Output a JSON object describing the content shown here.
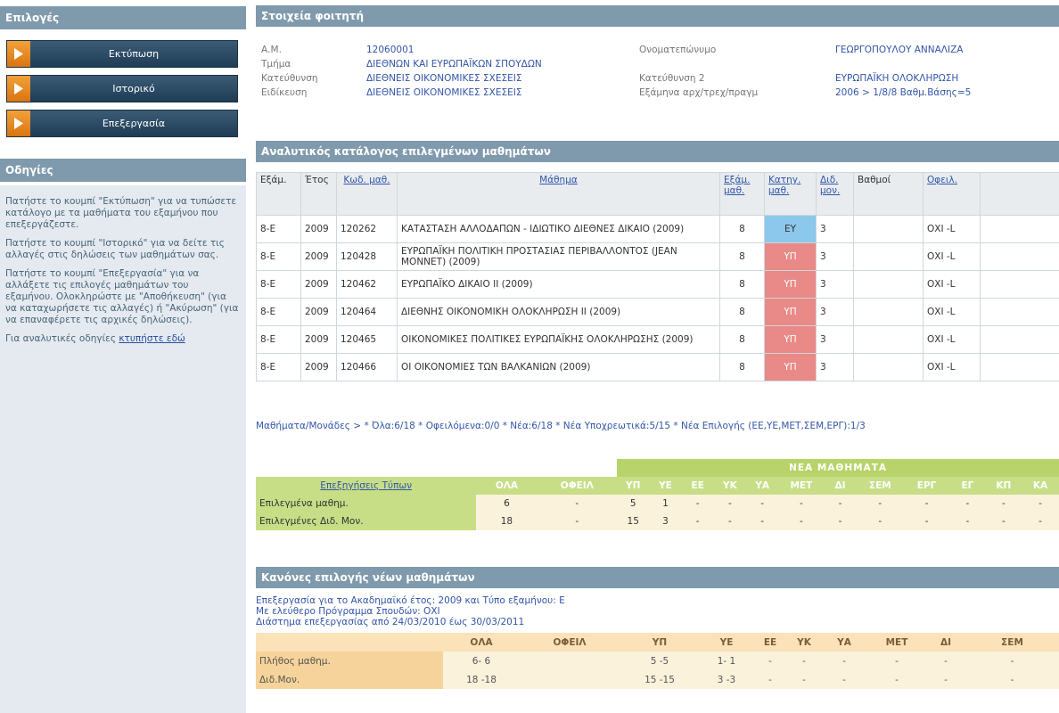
{
  "sidebar": {
    "options_title": "Επιλογές",
    "buttons": [
      {
        "label": "Εκτύπωση"
      },
      {
        "label": "Ιστορικό"
      },
      {
        "label": "Επεξεργασία"
      }
    ],
    "instructions_title": "Οδηγίες",
    "instructions": [
      "Πατήστε το κουμπί \"Εκτύπωση\" για να τυπώσετε κατάλογο με τα μαθήματα του εξαμήνου που επεξεργάζεστε.",
      "Πατήστε το κουμπί \"Ιστορικό\" για να δείτε τις αλλαγές στις δηλώσεις των μαθημάτων σας.",
      "Πατήστε το κουμπί \"Επεξεργασία\" για να αλλάξετε τις επιλογές μαθημάτων του εξαμήνου. Ολοκληρώστε με \"Αποθήκευση\" (για να καταχωρήσετε τις αλλαγές) ή \"Ακύρωση\" (για να επαναφέρετε τις αρχικές δηλώσεις)."
    ],
    "detailed_prefix": "Για αναλυτικές οδηγίες ",
    "detailed_link": "κτυπήστε εδώ"
  },
  "student": {
    "title": "Στοιχεία φοιτητή",
    "am_label": "Α.Μ.",
    "am_value": "12060001",
    "name_label": "Ονοματεπώνυμο",
    "name_value": "ΓΕΩΡΓΟΠΟΥΛΟΥ ΑΝΝΑΛΙΖΑ",
    "dept_label": "Τμήμα",
    "dept_value": "ΔΙΕΘΝΩΝ ΚΑΙ ΕΥΡΩΠΑΪΚΩΝ ΣΠΟΥΔΩΝ",
    "dir_label": "Κατεύθυνση",
    "dir_value": "ΔΙΕΘΝΕΙΣ ΟΙΚΟΝΟΜΙΚΕΣ ΣΧΕΣΕΙΣ",
    "dir2_label": "Κατεύθυνση 2",
    "dir2_value": "ΕΥΡΩΠΑΪΚΗ ΟΛΟΚΛΗΡΩΣΗ",
    "spec_label": "Ειδίκευση",
    "spec_value": "ΔΙΕΘΝΕΙΣ ΟΙΚΟΝΟΜΙΚΕΣ ΣΧΕΣΕΙΣ",
    "sem_label": "Εξάμηνα αρχ/τρεχ/πραγμ",
    "sem_value": "2006 > 1/8/8 Βαθμ.Βάσης=5"
  },
  "courses": {
    "title": "Αναλυτικός κατάλογος επιλεγμένων μαθημάτων",
    "headers": [
      "Εξάμ.",
      "Έτος",
      "Κωδ. μαθ.",
      "Μάθημα",
      "Εξάμ. μαθ.",
      "Κατηγ. μαθ.",
      "Διδ. μον.",
      "Βαθμοί",
      "Οφειλ."
    ],
    "rows": [
      {
        "sem": "8-Ε",
        "year": "2009",
        "code": "120262",
        "title": "ΚΑΤΑΣΤΑΣΗ ΑΛΛΟΔΑΠΩΝ - ΙΔΙΩΤΙΚΟ ΔΙΕΘΝΕΣ ΔΙΚΑΙΟ (2009)",
        "csem": "8",
        "cat": "ΕΥ",
        "units": "3",
        "grade": "",
        "owed": "ΟΧΙ -L"
      },
      {
        "sem": "8-Ε",
        "year": "2009",
        "code": "120428",
        "title": "ΕΥΡΩΠΑΪΚΗ ΠΟΛΙΤΙΚΗ ΠΡΟΣΤΑΣΙΑΣ ΠΕΡΙΒΑΛΛΟΝΤΟΣ (JEAN MONNET) (2009)",
        "csem": "8",
        "cat": "ΥΠ",
        "units": "3",
        "grade": "",
        "owed": "ΟΧΙ -L"
      },
      {
        "sem": "8-Ε",
        "year": "2009",
        "code": "120462",
        "title": "ΕΥΡΩΠΑΪΚΟ ΔΙΚΑΙΟ ΙΙ (2009)",
        "csem": "8",
        "cat": "ΥΠ",
        "units": "3",
        "grade": "",
        "owed": "ΟΧΙ -L"
      },
      {
        "sem": "8-Ε",
        "year": "2009",
        "code": "120464",
        "title": "ΔΙΕΘΝΗΣ ΟΙΚΟΝΟΜΙΚΗ ΟΛΟΚΛΗΡΩΣΗ ΙΙ (2009)",
        "csem": "8",
        "cat": "ΥΠ",
        "units": "3",
        "grade": "",
        "owed": "ΟΧΙ -L"
      },
      {
        "sem": "8-Ε",
        "year": "2009",
        "code": "120465",
        "title": "ΟΙΚΟΝΟΜΙΚΕΣ ΠΟΛΙΤΙΚΕΣ ΕΥΡΩΠΑΪΚΗΣ ΟΛΟΚΛΗΡΩΣΗΣ (2009)",
        "csem": "8",
        "cat": "ΥΠ",
        "units": "3",
        "grade": "",
        "owed": "ΟΧΙ -L"
      },
      {
        "sem": "8-Ε",
        "year": "2009",
        "code": "120466",
        "title": "ΟΙ ΟΙΚΟΝΟΜΙΕΣ ΤΩΝ ΒΑΛΚΑΝΙΩΝ (2009)",
        "csem": "8",
        "cat": "ΥΠ",
        "units": "3",
        "grade": "",
        "owed": "ΟΧΙ -L"
      }
    ],
    "summary": "Μαθήματα/Μονάδες > * Όλα:6/18 * Οφειλόμενα:0/0 * Νέα:6/18 * Νέα Υποχρεωτικά:5/15 * Νέα Επιλογής (ΕΕ,ΥΕ,ΜΕΤ,ΣΕΜ,ΕΡΓ):1/3"
  },
  "stats": {
    "nea_label": "ΝΕΑ ΜΑΘΗΜΑΤΑ",
    "type_link": "Επεξηγήσεις Τύπων",
    "headers": [
      "ΟΛΑ",
      "ΟΦΕΙΛ",
      "ΥΠ",
      "ΥΕ",
      "ΕΕ",
      "ΥΚ",
      "ΥΑ",
      "ΜΕΤ",
      "ΔΙ",
      "ΣΕΜ",
      "ΕΡΓ",
      "ΕΓ",
      "ΚΠ",
      "ΚΑ"
    ],
    "rows": [
      {
        "label": "Επιλεγμένα μαθημ.",
        "values": [
          "6",
          "-",
          "5",
          "1",
          "-",
          "-",
          "-",
          "-",
          "-",
          "-",
          "-",
          "-",
          "-",
          "-"
        ]
      },
      {
        "label": "Επιλεγμένες Διδ. Μον.",
        "values": [
          "18",
          "-",
          "15",
          "3",
          "-",
          "-",
          "-",
          "-",
          "-",
          "-",
          "-",
          "-",
          "-",
          "-"
        ]
      }
    ]
  },
  "rules": {
    "title": "Κανόνες επιλογής νέων μαθημάτων",
    "line1": "Επεξεργασία για το Ακαδημαϊκό έτος: 2009 και Τύπο εξαμήνου: Ε",
    "line2": "Με ελεύθερο Πρόγραμμα Σπουδών: ΟΧΙ",
    "line3": "Διάστημα επεξεργασίας από 24/03/2010 έως 30/03/2011",
    "headers": [
      "ΟΛΑ",
      "ΟΦΕΙΛ",
      "ΥΠ",
      "ΥΕ",
      "ΕΕ",
      "ΥΚ",
      "ΥΑ",
      "ΜΕΤ",
      "ΔΙ",
      "ΣΕΜ"
    ],
    "rows": [
      {
        "label": "Πλήθος μαθημ.",
        "values": [
          "6- 6",
          "",
          "5 -5",
          "1- 1",
          "-",
          "-",
          "-",
          "-",
          "-",
          "-"
        ]
      },
      {
        "label": "Διδ.Μον.",
        "values": [
          "18 -18",
          "",
          "15 -15",
          "3 -3",
          "-",
          "-",
          "-",
          "-",
          "-",
          "-"
        ]
      }
    ]
  },
  "colors": {
    "header_bar": "#7f9aac",
    "button_dark": "#1f3c55",
    "arrow_orange": "#e8891f",
    "cat_ey": "#8cc7ec",
    "cat_yp": "#e98a88",
    "green_header": "#c7de87",
    "cream_cell": "#fbf2dc",
    "link_blue": "#3356a8"
  }
}
